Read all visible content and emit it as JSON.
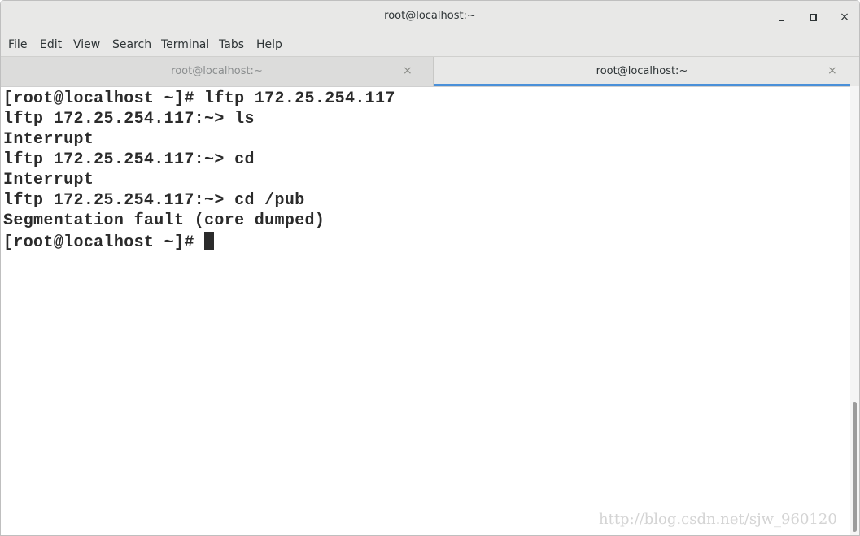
{
  "window": {
    "title": "root@localhost:~",
    "minimize_icon": "minimize-icon",
    "maximize_icon": "maximize-icon",
    "close_icon": "close-icon",
    "close_glyph": "×"
  },
  "menu": {
    "items": [
      "File",
      "Edit",
      "View",
      "Search",
      "Terminal",
      "Tabs",
      "Help"
    ]
  },
  "tabs": [
    {
      "label": "root@localhost:~",
      "active": false,
      "close_glyph": "×"
    },
    {
      "label": "root@localhost:~",
      "active": true,
      "close_glyph": "×"
    }
  ],
  "terminal": {
    "lines": [
      "[root@localhost ~]# lftp 172.25.254.117",
      "lftp 172.25.254.117:~> ls",
      "Interrupt",
      "lftp 172.25.254.117:~> cd",
      "Interrupt",
      "lftp 172.25.254.117:~> cd /pub",
      "Segmentation fault (core dumped)",
      "[root@localhost ~]# "
    ]
  },
  "watermark": "http://blog.csdn.net/sjw_960120",
  "colors": {
    "accent": "#4a90d9",
    "text": "#2b2b2b"
  }
}
